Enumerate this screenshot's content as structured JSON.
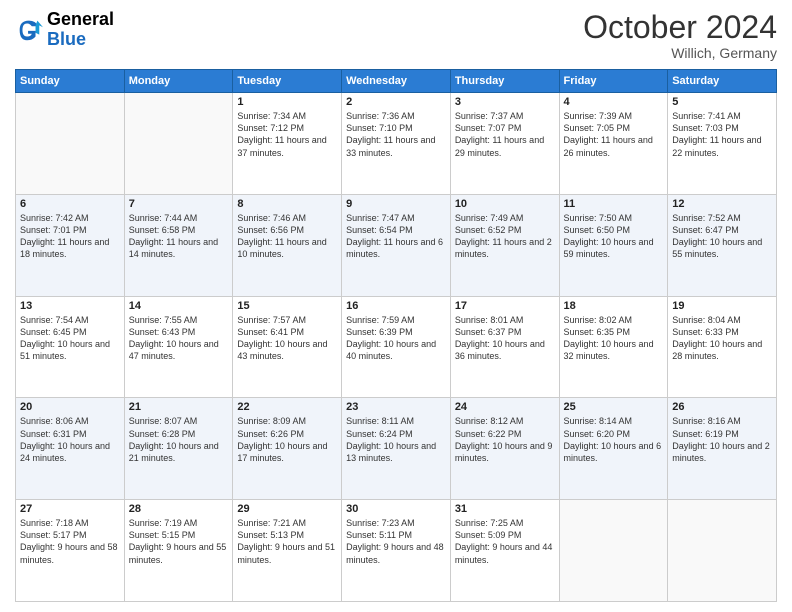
{
  "header": {
    "logo_line1": "General",
    "logo_line2": "Blue",
    "month_year": "October 2024",
    "location": "Willich, Germany"
  },
  "days_of_week": [
    "Sunday",
    "Monday",
    "Tuesday",
    "Wednesday",
    "Thursday",
    "Friday",
    "Saturday"
  ],
  "weeks": [
    [
      {
        "day": "",
        "sunrise": "",
        "sunset": "",
        "daylight": ""
      },
      {
        "day": "",
        "sunrise": "",
        "sunset": "",
        "daylight": ""
      },
      {
        "day": "1",
        "sunrise": "Sunrise: 7:34 AM",
        "sunset": "Sunset: 7:12 PM",
        "daylight": "Daylight: 11 hours and 37 minutes."
      },
      {
        "day": "2",
        "sunrise": "Sunrise: 7:36 AM",
        "sunset": "Sunset: 7:10 PM",
        "daylight": "Daylight: 11 hours and 33 minutes."
      },
      {
        "day": "3",
        "sunrise": "Sunrise: 7:37 AM",
        "sunset": "Sunset: 7:07 PM",
        "daylight": "Daylight: 11 hours and 29 minutes."
      },
      {
        "day": "4",
        "sunrise": "Sunrise: 7:39 AM",
        "sunset": "Sunset: 7:05 PM",
        "daylight": "Daylight: 11 hours and 26 minutes."
      },
      {
        "day": "5",
        "sunrise": "Sunrise: 7:41 AM",
        "sunset": "Sunset: 7:03 PM",
        "daylight": "Daylight: 11 hours and 22 minutes."
      }
    ],
    [
      {
        "day": "6",
        "sunrise": "Sunrise: 7:42 AM",
        "sunset": "Sunset: 7:01 PM",
        "daylight": "Daylight: 11 hours and 18 minutes."
      },
      {
        "day": "7",
        "sunrise": "Sunrise: 7:44 AM",
        "sunset": "Sunset: 6:58 PM",
        "daylight": "Daylight: 11 hours and 14 minutes."
      },
      {
        "day": "8",
        "sunrise": "Sunrise: 7:46 AM",
        "sunset": "Sunset: 6:56 PM",
        "daylight": "Daylight: 11 hours and 10 minutes."
      },
      {
        "day": "9",
        "sunrise": "Sunrise: 7:47 AM",
        "sunset": "Sunset: 6:54 PM",
        "daylight": "Daylight: 11 hours and 6 minutes."
      },
      {
        "day": "10",
        "sunrise": "Sunrise: 7:49 AM",
        "sunset": "Sunset: 6:52 PM",
        "daylight": "Daylight: 11 hours and 2 minutes."
      },
      {
        "day": "11",
        "sunrise": "Sunrise: 7:50 AM",
        "sunset": "Sunset: 6:50 PM",
        "daylight": "Daylight: 10 hours and 59 minutes."
      },
      {
        "day": "12",
        "sunrise": "Sunrise: 7:52 AM",
        "sunset": "Sunset: 6:47 PM",
        "daylight": "Daylight: 10 hours and 55 minutes."
      }
    ],
    [
      {
        "day": "13",
        "sunrise": "Sunrise: 7:54 AM",
        "sunset": "Sunset: 6:45 PM",
        "daylight": "Daylight: 10 hours and 51 minutes."
      },
      {
        "day": "14",
        "sunrise": "Sunrise: 7:55 AM",
        "sunset": "Sunset: 6:43 PM",
        "daylight": "Daylight: 10 hours and 47 minutes."
      },
      {
        "day": "15",
        "sunrise": "Sunrise: 7:57 AM",
        "sunset": "Sunset: 6:41 PM",
        "daylight": "Daylight: 10 hours and 43 minutes."
      },
      {
        "day": "16",
        "sunrise": "Sunrise: 7:59 AM",
        "sunset": "Sunset: 6:39 PM",
        "daylight": "Daylight: 10 hours and 40 minutes."
      },
      {
        "day": "17",
        "sunrise": "Sunrise: 8:01 AM",
        "sunset": "Sunset: 6:37 PM",
        "daylight": "Daylight: 10 hours and 36 minutes."
      },
      {
        "day": "18",
        "sunrise": "Sunrise: 8:02 AM",
        "sunset": "Sunset: 6:35 PM",
        "daylight": "Daylight: 10 hours and 32 minutes."
      },
      {
        "day": "19",
        "sunrise": "Sunrise: 8:04 AM",
        "sunset": "Sunset: 6:33 PM",
        "daylight": "Daylight: 10 hours and 28 minutes."
      }
    ],
    [
      {
        "day": "20",
        "sunrise": "Sunrise: 8:06 AM",
        "sunset": "Sunset: 6:31 PM",
        "daylight": "Daylight: 10 hours and 24 minutes."
      },
      {
        "day": "21",
        "sunrise": "Sunrise: 8:07 AM",
        "sunset": "Sunset: 6:28 PM",
        "daylight": "Daylight: 10 hours and 21 minutes."
      },
      {
        "day": "22",
        "sunrise": "Sunrise: 8:09 AM",
        "sunset": "Sunset: 6:26 PM",
        "daylight": "Daylight: 10 hours and 17 minutes."
      },
      {
        "day": "23",
        "sunrise": "Sunrise: 8:11 AM",
        "sunset": "Sunset: 6:24 PM",
        "daylight": "Daylight: 10 hours and 13 minutes."
      },
      {
        "day": "24",
        "sunrise": "Sunrise: 8:12 AM",
        "sunset": "Sunset: 6:22 PM",
        "daylight": "Daylight: 10 hours and 9 minutes."
      },
      {
        "day": "25",
        "sunrise": "Sunrise: 8:14 AM",
        "sunset": "Sunset: 6:20 PM",
        "daylight": "Daylight: 10 hours and 6 minutes."
      },
      {
        "day": "26",
        "sunrise": "Sunrise: 8:16 AM",
        "sunset": "Sunset: 6:19 PM",
        "daylight": "Daylight: 10 hours and 2 minutes."
      }
    ],
    [
      {
        "day": "27",
        "sunrise": "Sunrise: 7:18 AM",
        "sunset": "Sunset: 5:17 PM",
        "daylight": "Daylight: 9 hours and 58 minutes."
      },
      {
        "day": "28",
        "sunrise": "Sunrise: 7:19 AM",
        "sunset": "Sunset: 5:15 PM",
        "daylight": "Daylight: 9 hours and 55 minutes."
      },
      {
        "day": "29",
        "sunrise": "Sunrise: 7:21 AM",
        "sunset": "Sunset: 5:13 PM",
        "daylight": "Daylight: 9 hours and 51 minutes."
      },
      {
        "day": "30",
        "sunrise": "Sunrise: 7:23 AM",
        "sunset": "Sunset: 5:11 PM",
        "daylight": "Daylight: 9 hours and 48 minutes."
      },
      {
        "day": "31",
        "sunrise": "Sunrise: 7:25 AM",
        "sunset": "Sunset: 5:09 PM",
        "daylight": "Daylight: 9 hours and 44 minutes."
      },
      {
        "day": "",
        "sunrise": "",
        "sunset": "",
        "daylight": ""
      },
      {
        "day": "",
        "sunrise": "",
        "sunset": "",
        "daylight": ""
      }
    ]
  ]
}
